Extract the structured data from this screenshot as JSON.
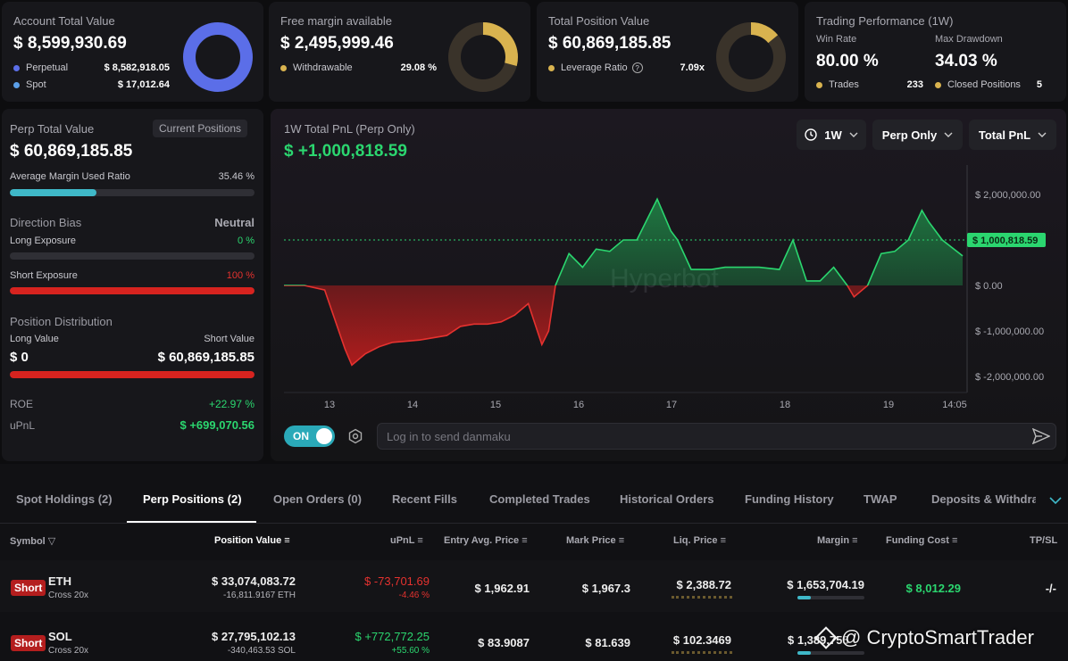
{
  "cards": {
    "account": {
      "title": "Account Total Value",
      "value": "$ 8,599,930.69",
      "rows": [
        {
          "label": "Perpetual",
          "value": "$ 8,582,918.05",
          "color": "#5b6ee8"
        },
        {
          "label": "Spot",
          "value": "$ 17,012.64",
          "color": "#5b9fe8"
        }
      ],
      "donut_fraction": 0.998
    },
    "free_margin": {
      "title": "Free margin available",
      "value": "$ 2,495,999.46",
      "row_label": "Withdrawable",
      "row_value": "29.08 %",
      "donut_fraction": 0.2908
    },
    "position": {
      "title": "Total Position Value",
      "value": "$ 60,869,185.85",
      "row_label": "Leverage Ratio",
      "row_value": "7.09x",
      "donut_fraction": 0.14
    },
    "performance": {
      "title": "Trading Performance (1W)",
      "win_rate_label": "Win Rate",
      "win_rate": "80.00 %",
      "drawdown_label": "Max Drawdown",
      "drawdown": "34.03 %",
      "trades_label": "Trades",
      "trades": "233",
      "closed_label": "Closed Positions",
      "closed": "5"
    }
  },
  "perp": {
    "title": "Perp Total Value",
    "tag": "Current Positions",
    "value": "$ 60,869,185.85",
    "margin_label": "Average Margin Used Ratio",
    "margin_value": "35.46 %",
    "margin_fraction": 0.3546,
    "bias_label": "Direction Bias",
    "bias_value": "Neutral",
    "long_label": "Long Exposure",
    "long_value": "0 %",
    "long_fraction": 0,
    "short_label": "Short Exposure",
    "short_value": "100 %",
    "short_fraction": 1,
    "dist_label": "Position Distribution",
    "long_val_label": "Long Value",
    "short_val_label": "Short Value",
    "long_val": "$ 0",
    "short_val": "$ 60,869,185.85",
    "roe_label": "ROE",
    "roe": "+22.97 %",
    "upnl_label": "uPnL",
    "upnl": "$ +699,070.56"
  },
  "chart_panel": {
    "title": "1W Total PnL (Perp Only)",
    "value": "$ +1,000,818.59",
    "period": "1W",
    "scope": "Perp Only",
    "metric": "Total PnL",
    "watermark": "Hyperbot",
    "toggle": "ON",
    "danmaku_placeholder": "Log in to send danmaku"
  },
  "chart_data": {
    "type": "area",
    "xlabel": "",
    "ylabel": "",
    "x_ticks": [
      "13",
      "14",
      "15",
      "16",
      "17",
      "18",
      "19",
      "14:05"
    ],
    "y_ticks": [
      "$ 2,000,000.00",
      "$ 1,000,000.00",
      "$ 0.00",
      "$ -1,000,000.00",
      "$ -2,000,000.00"
    ],
    "ylim": [
      -2000000,
      2000000
    ],
    "current_label": "$ 1,000,818.59",
    "current_value": 1000818.59,
    "x": [
      0,
      0.03,
      0.06,
      0.09,
      0.1,
      0.12,
      0.14,
      0.16,
      0.2,
      0.24,
      0.26,
      0.28,
      0.3,
      0.32,
      0.34,
      0.36,
      0.38,
      0.39,
      0.4,
      0.42,
      0.44,
      0.46,
      0.48,
      0.5,
      0.52,
      0.55,
      0.57,
      0.58,
      0.6,
      0.63,
      0.65,
      0.7,
      0.73,
      0.75,
      0.77,
      0.79,
      0.81,
      0.83,
      0.84,
      0.86,
      0.88,
      0.9,
      0.92,
      0.94,
      0.95,
      0.97,
      1.0
    ],
    "y": [
      0,
      0,
      -100000,
      -1400000,
      -1750000,
      -1500000,
      -1350000,
      -1250000,
      -1200000,
      -1100000,
      -900000,
      -850000,
      -850000,
      -800000,
      -650000,
      -400000,
      -1300000,
      -1000000,
      0,
      700000,
      400000,
      800000,
      750000,
      1000000,
      1000000,
      1900000,
      1200000,
      1000000,
      350000,
      350000,
      400000,
      400000,
      350000,
      1000000,
      100000,
      100000,
      400000,
      0,
      -250000,
      0,
      700000,
      750000,
      1000000,
      1650000,
      1400000,
      1000000,
      650000
    ]
  },
  "tabs": [
    "Spot Holdings (2)",
    "Perp Positions (2)",
    "Open Orders (0)",
    "Recent Fills",
    "Completed Trades",
    "Historical Orders",
    "Funding History",
    "TWAP",
    "Deposits & Withdraw"
  ],
  "table": {
    "headers": [
      "Symbol",
      "Position Value",
      "uPnL",
      "Entry Avg. Price",
      "Mark Price",
      "Liq. Price",
      "Margin",
      "Funding Cost",
      "TP/SL"
    ],
    "rows": [
      {
        "side": "Short",
        "symbol": "ETH",
        "mode": "Cross 20x",
        "value": "$ 33,074,083.72",
        "size": "-16,811.9167 ETH",
        "upnl": "$ -73,701.69",
        "upnl_pct": "-4.46 %",
        "entry": "$ 1,962.91",
        "mark": "$ 1,967.3",
        "liq": "$ 2,388.72",
        "margin": "$ 1,653,704.19",
        "funding": "$ 8,012.29",
        "tpsl": "-/-"
      },
      {
        "side": "Short",
        "symbol": "SOL",
        "mode": "Cross 20x",
        "value": "$ 27,795,102.13",
        "size": "-340,463.53 SOL",
        "upnl": "$ +772,772.25",
        "upnl_pct": "+55.60 %",
        "entry": "$ 83.9087",
        "mark": "$ 81.639",
        "liq": "$ 102.3469",
        "margin": "$ 1,389,755",
        "funding": "",
        "tpsl": ""
      }
    ]
  },
  "watermark_text": "@ CryptoSmartTrader"
}
